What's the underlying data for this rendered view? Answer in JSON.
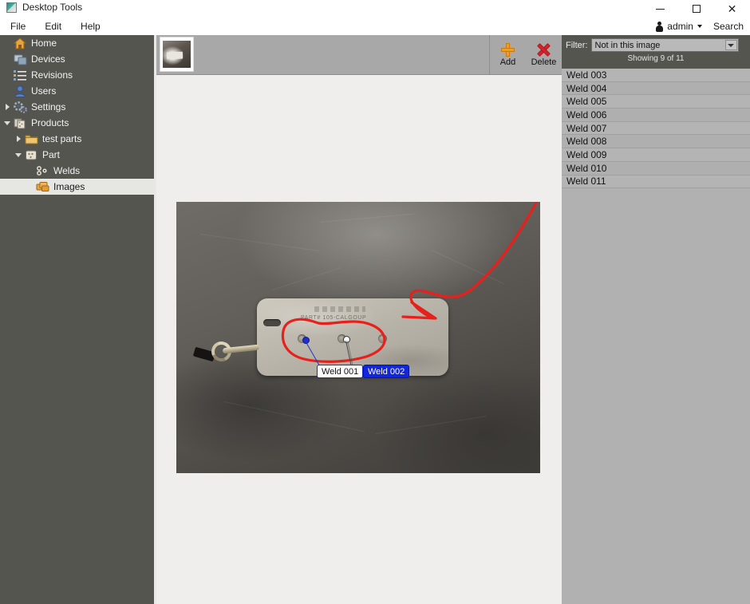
{
  "window": {
    "title": "Desktop Tools",
    "app_icon": "app-icon",
    "minimize": "minimize-icon",
    "maximize": "maximize-icon",
    "close": "close-icon"
  },
  "menubar": {
    "items": [
      {
        "label": "File"
      },
      {
        "label": "Edit"
      },
      {
        "label": "Help"
      }
    ],
    "account": {
      "icon": "person-icon",
      "name": "admin",
      "caret": "chevron-down-icon"
    },
    "search_label": "Search"
  },
  "sidebar": {
    "items": [
      {
        "label": "Home",
        "icon": "home-icon",
        "indent": 0,
        "twisty": "none",
        "selected": false
      },
      {
        "label": "Devices",
        "icon": "devices-icon",
        "indent": 0,
        "twisty": "none",
        "selected": false
      },
      {
        "label": "Revisions",
        "icon": "revisions-icon",
        "indent": 0,
        "twisty": "none",
        "selected": false
      },
      {
        "label": "Users",
        "icon": "users-icon",
        "indent": 0,
        "twisty": "none",
        "selected": false
      },
      {
        "label": "Settings",
        "icon": "settings-icon",
        "indent": 0,
        "twisty": "closed",
        "selected": false
      },
      {
        "label": "Products",
        "icon": "products-icon",
        "indent": 0,
        "twisty": "open",
        "selected": false
      },
      {
        "label": "test parts",
        "icon": "folder-icon",
        "indent": 1,
        "twisty": "closed",
        "selected": false
      },
      {
        "label": "Part",
        "icon": "part-icon",
        "indent": 1,
        "twisty": "open",
        "selected": false
      },
      {
        "label": "Welds",
        "icon": "welds-icon",
        "indent": 2,
        "twisty": "none",
        "selected": false
      },
      {
        "label": "Images",
        "icon": "images-icon",
        "indent": 2,
        "twisty": "none",
        "selected": true
      }
    ]
  },
  "toolbar": {
    "thumbnail_name": "image-thumbnail-1",
    "add_label": "Add",
    "add_icon": "plus-icon",
    "delete_label": "Delete",
    "delete_icon": "x-icon"
  },
  "canvas": {
    "photo_alt": "metal tag photo with red annotations",
    "plate_stamp_text": "PART# 105-CALGOUP",
    "annotations": [
      {
        "label": "Weld 001",
        "state": "normal",
        "marker": "filled"
      },
      {
        "label": "Weld 002",
        "state": "selected",
        "marker": "hollow"
      }
    ]
  },
  "right_panel": {
    "filter_label": "Filter:",
    "filter_value": "Not in this image",
    "filter_options": [
      "Not in this image"
    ],
    "showing_text": "Showing 9 of 11",
    "welds": [
      {
        "label": "Weld 003"
      },
      {
        "label": "Weld 004"
      },
      {
        "label": "Weld 005"
      },
      {
        "label": "Weld 006"
      },
      {
        "label": "Weld 007"
      },
      {
        "label": "Weld 008"
      },
      {
        "label": "Weld 009"
      },
      {
        "label": "Weld 010"
      },
      {
        "label": "Weld 011"
      }
    ]
  },
  "colors": {
    "sidebar_bg": "#555550",
    "canvas_bg": "#efeeec",
    "right_panel_bg": "#b1b1b1",
    "toolbar_bg": "#a8a8a8",
    "selection_blue": "#1327d8",
    "annotation_red": "#e8201c",
    "add_orange": "#ef9f20",
    "delete_red": "#d3242b"
  }
}
